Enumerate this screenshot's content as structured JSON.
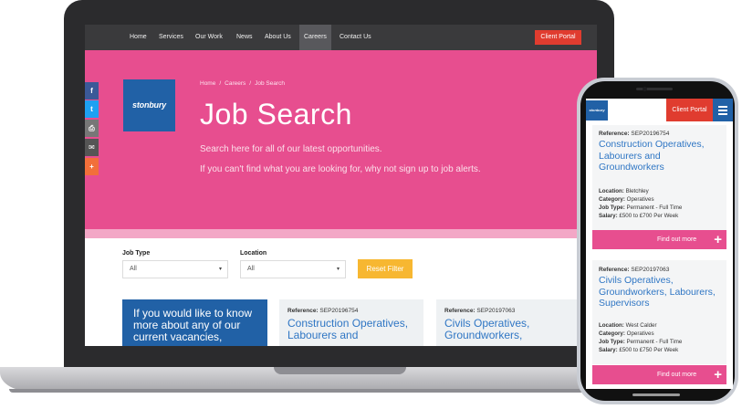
{
  "nav": {
    "items": [
      "Home",
      "Services",
      "Our Work",
      "News",
      "About Us",
      "Careers",
      "Contact Us"
    ],
    "active": "Careers",
    "portal_label": "Client Portal"
  },
  "logo": {
    "text": "stonbury",
    "color": "#2161a6"
  },
  "hero": {
    "breadcrumb": [
      "Home",
      "Careers",
      "Job Search"
    ],
    "title": "Job Search",
    "line1": "Search here for all of our latest opportunities.",
    "line2": "If you can't find what you are looking for, why not sign up to job alerts.",
    "color": "#e74e8f"
  },
  "share": [
    {
      "icon": "facebook-icon",
      "glyph": "f",
      "color": "#3b5998"
    },
    {
      "icon": "twitter-icon",
      "glyph": "t",
      "color": "#1da1f2"
    },
    {
      "icon": "print-icon",
      "glyph": "⎙",
      "color": "#777777"
    },
    {
      "icon": "email-icon",
      "glyph": "✉",
      "color": "#555555"
    },
    {
      "icon": "plus-icon",
      "glyph": "+",
      "color": "#f26f3a"
    }
  ],
  "filters": {
    "job_type_label": "Job Type",
    "job_type_value": "All",
    "location_label": "Location",
    "location_value": "All",
    "reset_label": "Reset Filter"
  },
  "info_card": {
    "text": "If you would like to know more about any of our current vacancies,"
  },
  "jobs": [
    {
      "ref_label": "Reference:",
      "ref": "SEP20196754",
      "title": "Construction Operatives, Labourers and Groundworkers",
      "location": "Bletchley",
      "category": "Operatives",
      "job_type": "Permanent - Full Time",
      "salary": "£500 to £700 Per Week"
    },
    {
      "ref_label": "Reference:",
      "ref": "SEP20197063",
      "title": "Civils Operatives, Groundworkers, Labourers, Supervisors",
      "location": "West Calder",
      "category": "Operatives",
      "job_type": "Permanent - Full Time",
      "salary": "£500 to £750 Per Week"
    }
  ],
  "meta_labels": {
    "location": "Location:",
    "category": "Category:",
    "job_type": "Job Type:",
    "salary": "Salary:"
  },
  "phone": {
    "portal_label": "Client Portal",
    "find_label": "Find out more"
  },
  "desktop_card_titles": [
    "Construction Operatives, Labourers and",
    "Civils Operatives, Groundworkers,"
  ]
}
